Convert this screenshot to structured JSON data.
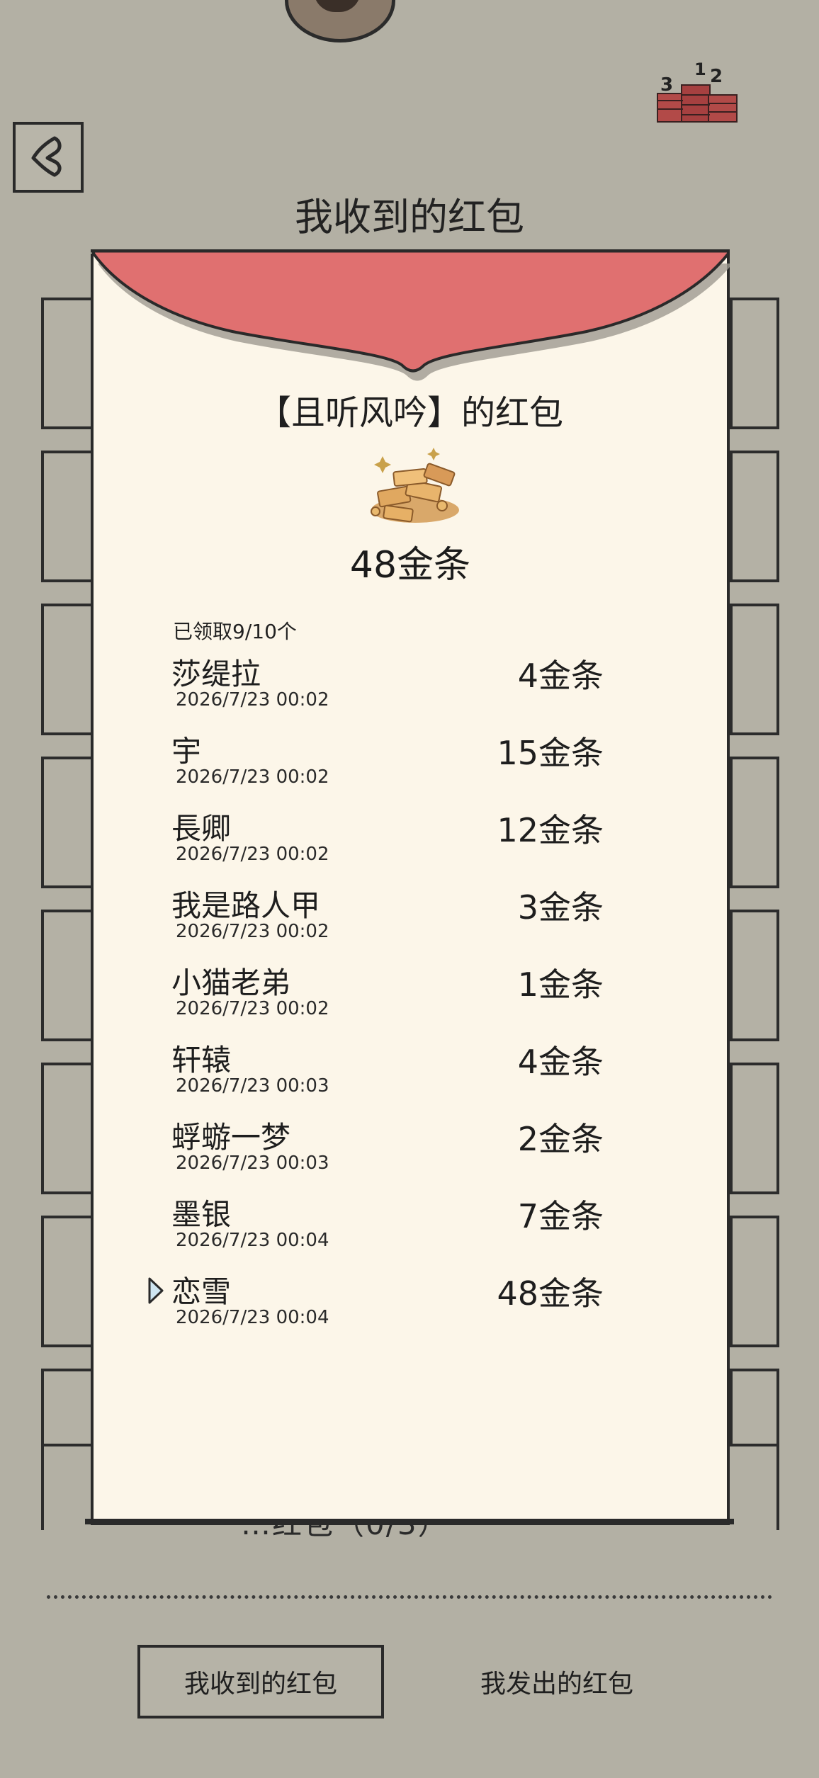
{
  "header": {
    "title": "我收到的红包",
    "back_icon": "chevron-left-icon",
    "rank_icon": "leaderboard-icon"
  },
  "background": {
    "tabs_behind_label": "…红包（0/3）"
  },
  "packet": {
    "sender_title": "【且听风吟】的红包",
    "total_amount": "48金条",
    "claimed_status": "已领取9/10个",
    "flap_color": "#e07070",
    "gold_icon": "gold-bars-icon"
  },
  "recipients": [
    {
      "name": "莎缇拉",
      "time": "2026/7/23 00:02",
      "amount": "4金条"
    },
    {
      "name": "宇",
      "time": "2026/7/23 00:02",
      "amount": "15金条"
    },
    {
      "name": "長卿",
      "time": "2026/7/23 00:02",
      "amount": "12金条"
    },
    {
      "name": "我是路人甲",
      "time": "2026/7/23 00:02",
      "amount": "3金条"
    },
    {
      "name": "小猫老弟",
      "time": "2026/7/23 00:02",
      "amount": "1金条"
    },
    {
      "name": "轩辕",
      "time": "2026/7/23 00:03",
      "amount": "4金条"
    },
    {
      "name": "蜉蝣一梦",
      "time": "2026/7/23 00:03",
      "amount": "2金条"
    },
    {
      "name": "墨银",
      "time": "2026/7/23 00:04",
      "amount": "7金条"
    },
    {
      "name": "恋雪",
      "time": "2026/7/23 00:04",
      "amount": "48金条",
      "highlight": true
    }
  ],
  "bottom_tabs": {
    "received_label": "我收到的红包",
    "sent_label": "我发出的红包"
  }
}
